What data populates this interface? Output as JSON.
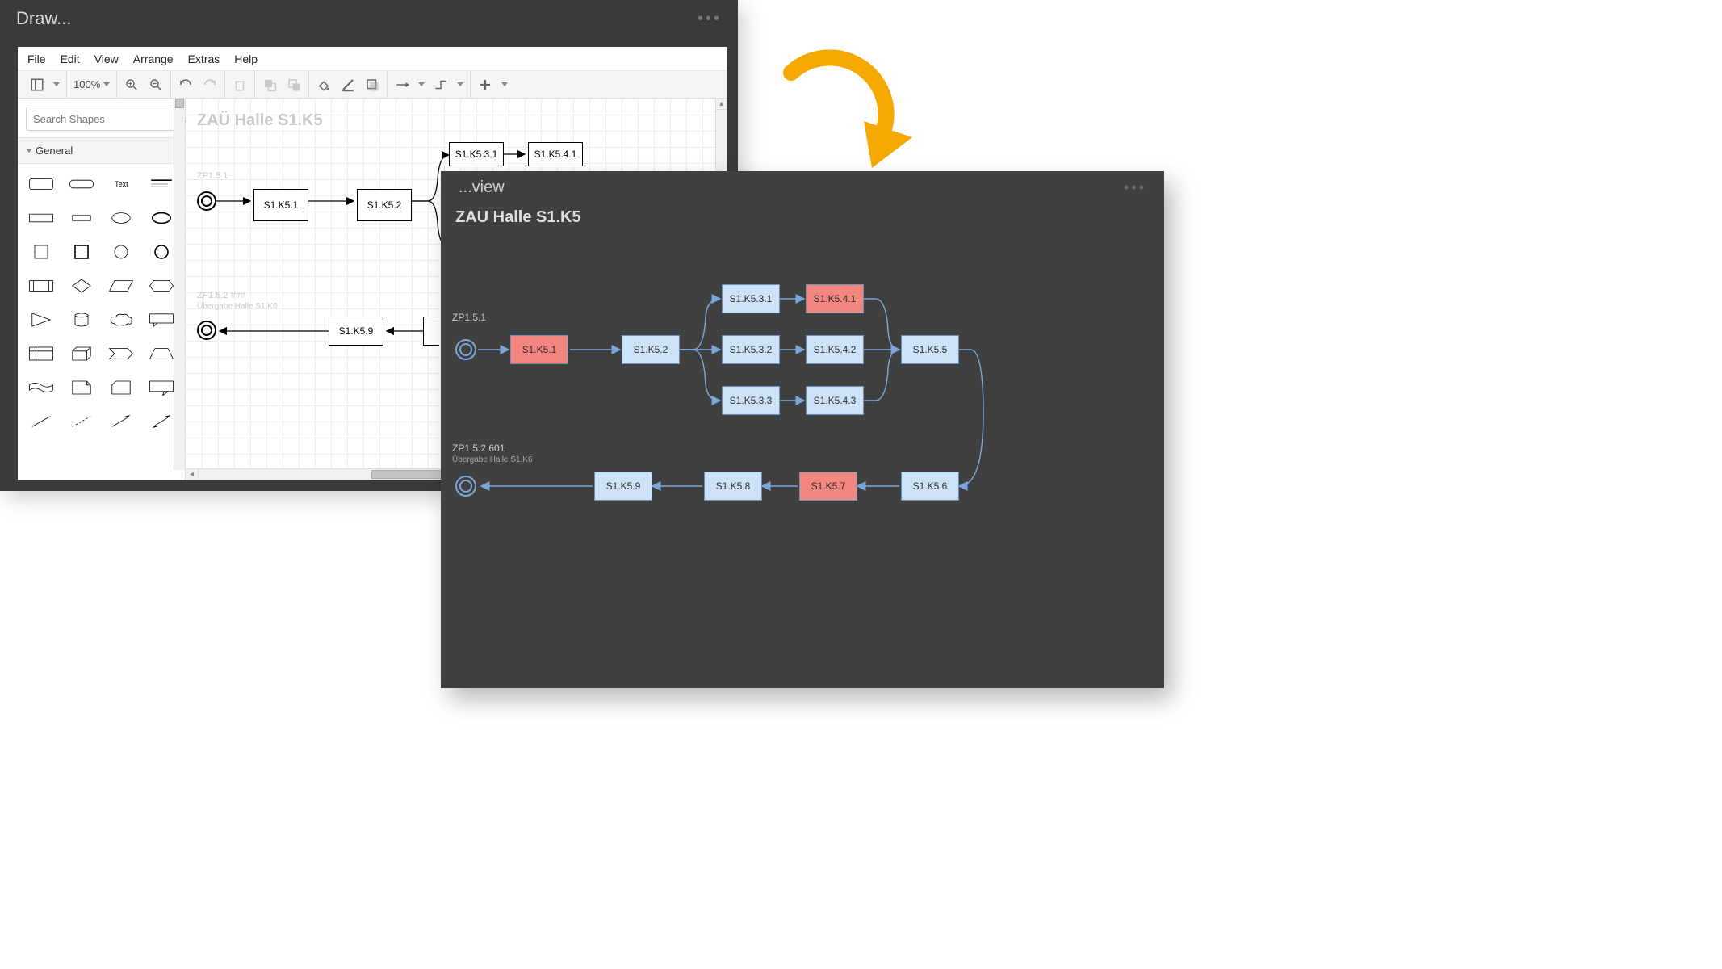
{
  "draw": {
    "title": "Draw...",
    "menus": [
      "File",
      "Edit",
      "View",
      "Arrange",
      "Extras",
      "Help"
    ],
    "zoom": "100%",
    "search_placeholder": "Search Shapes",
    "section_label": "General",
    "shape_text": "Text",
    "canvas_title": "ZAÜ Halle S1.K5",
    "zp1": "ZP1.5.1",
    "zp2": "ZP1.5.2   ###",
    "zp2_sub": "Übergabe Halle S1.K6",
    "boxes": {
      "k51": "S1.K5.1",
      "k52": "S1.K5.2",
      "k531": "S1.K5.3.1",
      "k541": "S1.K5.4.1",
      "k59": "S1.K5.9"
    }
  },
  "view": {
    "title": "...view",
    "heading": "ZAU Halle S1.K5",
    "zp1": "ZP1.5.1",
    "zp2": "ZP1.5.2   601",
    "zp2_sub": "Übergabe Halle S1.K6",
    "nodes": {
      "k51": "S1.K5.1",
      "k52": "S1.K5.2",
      "k531": "S1.K5.3.1",
      "k541": "S1.K5.4.1",
      "k532": "S1.K5.3.2",
      "k542": "S1.K5.4.2",
      "k533": "S1.K5.3.3",
      "k543": "S1.K5.4.3",
      "k55": "S1.K5.5",
      "k56": "S1.K5.6",
      "k57": "S1.K5.7",
      "k58": "S1.K5.8",
      "k59": "S1.K5.9"
    }
  }
}
